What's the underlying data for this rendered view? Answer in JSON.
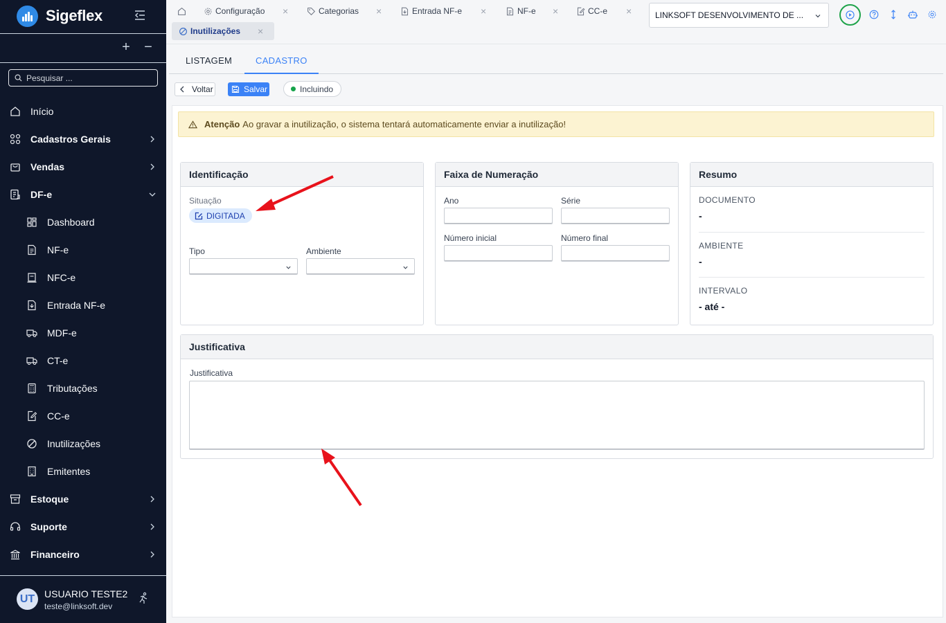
{
  "brand": {
    "name": "Sigeflex"
  },
  "sidebar": {
    "expand_all": "+",
    "collapse_all": "−",
    "search_placeholder": "Pesquisar ...",
    "items": {
      "inicio": "Início",
      "cadastros": "Cadastros Gerais",
      "vendas": "Vendas",
      "dfe": "DF-e",
      "dashboard": "Dashboard",
      "nfe": "NF-e",
      "nfce": "NFC-e",
      "entrada": "Entrada NF-e",
      "mdfe": "MDF-e",
      "cte": "CT-e",
      "tributacoes": "Tributações",
      "cce": "CC-e",
      "inutilizacoes": "Inutilizações",
      "emitentes": "Emitentes",
      "estoque": "Estoque",
      "suporte": "Suporte",
      "financeiro": "Financeiro"
    }
  },
  "user": {
    "initials": "UT",
    "name": "USUARIO TESTE2",
    "email": "teste@linksoft.dev"
  },
  "tabs": {
    "config": "Configuração",
    "categorias": "Categorias",
    "entrada": "Entrada NF-e",
    "nfe": "NF-e",
    "cce": "CC-e",
    "inutilizacoes": "Inutilizações",
    "close": "×"
  },
  "company": {
    "value": "LINKSOFT DESENVOLVIMENTO DE ..."
  },
  "subtabs": {
    "list": "LISTAGEM",
    "cadastro": "CADASTRO"
  },
  "actions": {
    "voltar": "Voltar",
    "salvar": "Salvar",
    "status": "Incluindo"
  },
  "warning": {
    "title": "Atenção",
    "text": "Ao gravar a inutilização, o sistema tentará automaticamente enviar a inutilização!"
  },
  "identificacao": {
    "title": "Identificação",
    "situacao_label": "Situação",
    "situacao_value": "DIGITADA",
    "tipo_label": "Tipo",
    "ambiente_label": "Ambiente"
  },
  "faixa": {
    "title": "Faixa de Numeração",
    "ano_label": "Ano",
    "serie_label": "Série",
    "num_ini_label": "Número inicial",
    "num_fim_label": "Número final"
  },
  "resumo": {
    "title": "Resumo",
    "documento_label": "DOCUMENTO",
    "documento_value": "-",
    "ambiente_label": "AMBIENTE",
    "ambiente_value": "-",
    "intervalo_label": "INTERVALO",
    "intervalo_value": "- até -"
  },
  "justificativa": {
    "title": "Justificativa",
    "label": "Justificativa"
  },
  "colors": {
    "sidebar_bg": "#0f172a",
    "accent": "#3b82f6",
    "annotation_arrow": "#e8121b",
    "play_ring": "#1fa34a"
  }
}
